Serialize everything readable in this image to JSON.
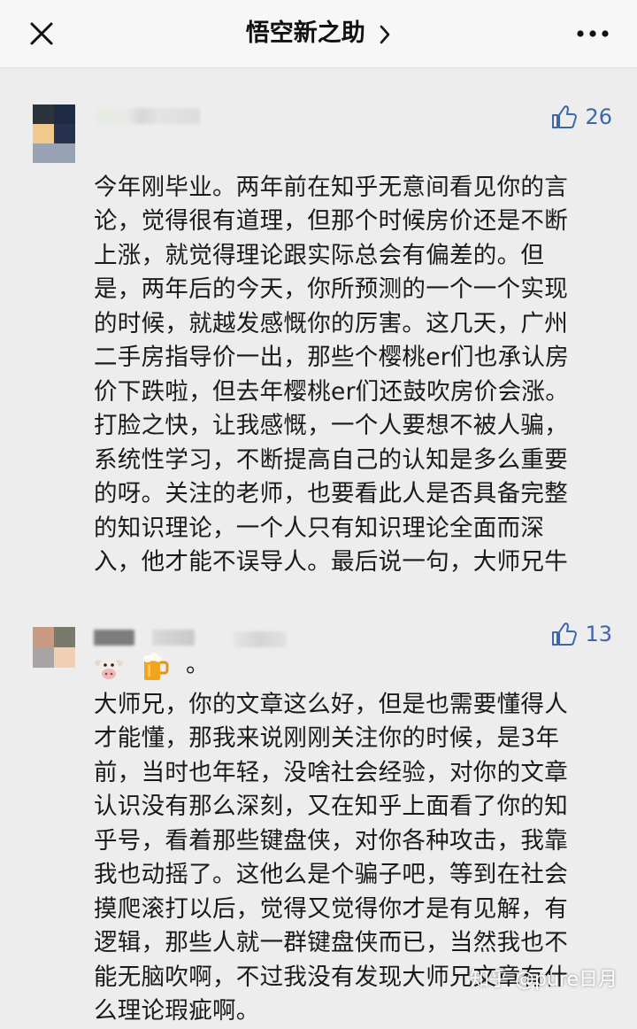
{
  "nav": {
    "title": "悟空新之助"
  },
  "comments": [
    {
      "likes": "26",
      "text": "今年刚毕业。两年前在知乎无意间看见你的言\n论，觉得很有道理，但那个时候房价还是不断\n上涨，就觉得理论跟实际总会有偏差的。但\n是，两年后的今天，你所预测的一个一个实现\n的时候，就越发感慨你的厉害。这几天，广州\n二手房指导价一出，那些个樱桃er们也承认房\n价下跌啦，但去年樱桃er们还鼓吹房价会涨。\n打脸之快，让我感慨，一个人要想不被人骗，\n系统性学习，不断提高自己的认知是多么重要\n的呀。关注的老师，也要看此人是否具备完整\n的知识理论，一个人只有知识理论全面而深\n入，他才能不误导人。最后说一句，大师兄牛",
      "ending": "。"
    },
    {
      "likes": "13",
      "text": "大师兄，你的文章这么好，但是也需要懂得人\n才能懂，那我来说刚刚关注你的时候，是3年\n前，当时也年轻，没啥社会经验，对你的文章\n认识没有那么深刻，又在知乎上面看了你的知\n乎号，看着那些键盘侠，对你各种攻击，我靠\n我也动摇了。这他么是个骗子吧，等到在社会\n摸爬滚打以后，觉得又觉得你才是有见解，有\n逻辑，那些人就一群键盘侠而已，当然我也不\n能无脑吹啊，不过我没有发现大师兄文章有什\n么理论瑕疵啊。"
    }
  ],
  "watermark": "知乎 @pure日月",
  "colors": {
    "like_blue": "#3f66a8",
    "background": "#ededed",
    "nav_background": "#f7f7f7"
  },
  "icons": [
    "close-icon",
    "chevron-right-icon",
    "more-icon",
    "thumbs-up-icon",
    "cow-emoji-icon",
    "beer-emoji-icon"
  ]
}
